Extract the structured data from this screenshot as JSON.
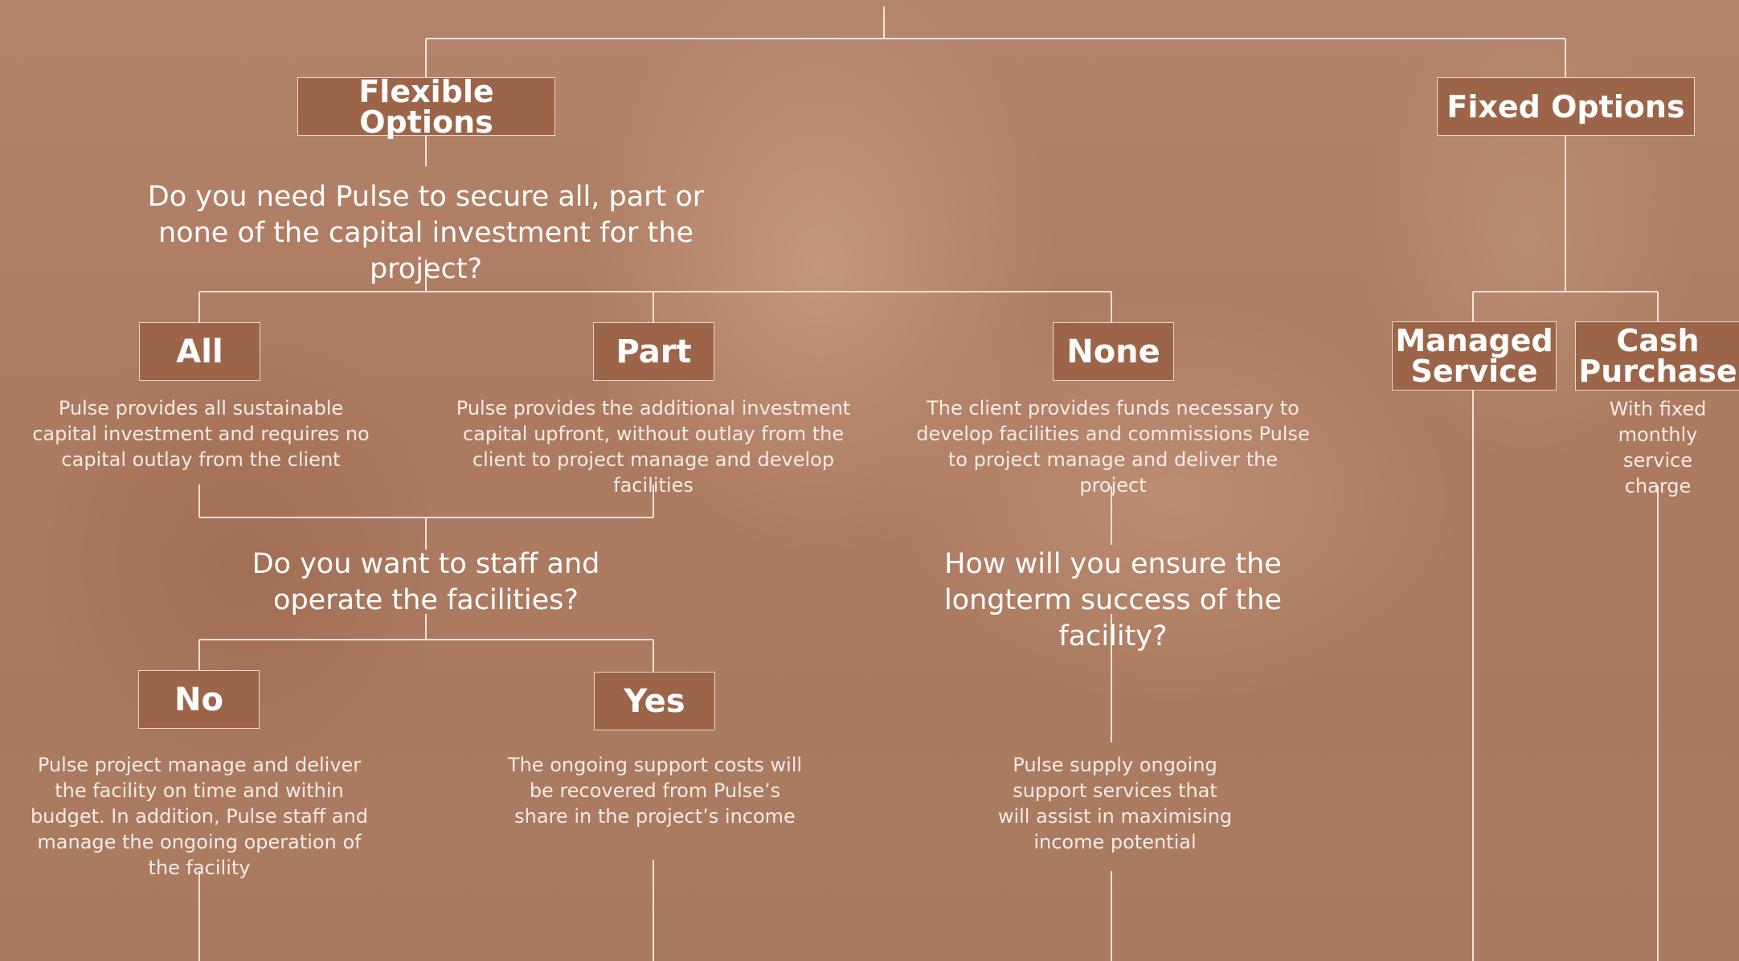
{
  "diagram": {
    "flexible": {
      "title": "Flexible Options",
      "question": "Do you need Pulse to secure all, part or none of the capital investment for the project?",
      "options": {
        "all": {
          "label": "All",
          "desc": "Pulse provides all sustainable capital investment and requires no capital outlay from the client"
        },
        "part": {
          "label": "Part",
          "desc": "Pulse provides the additional investment capital upfront, without outlay from the client to project manage and develop facilities"
        },
        "none": {
          "label": "None",
          "desc": "The client provides funds necessary to develop facilities and commissions Pulse to project manage and deliver the project"
        }
      },
      "staff_question": "Do you want to staff and operate the facilities?",
      "staff_options": {
        "no": {
          "label": "No",
          "desc": "Pulse project manage and deliver the facility on time and within budget. In addition, Pulse staff and manage the ongoing operation of the facility"
        },
        "yes": {
          "label": "Yes",
          "desc": "The ongoing support costs will be recovered from Pulse’s share in the project’s income"
        }
      },
      "success_question": "How will you ensure the longterm success of the facility?",
      "success_desc": "Pulse supply ongoing support services that will assist in maximising income potential"
    },
    "fixed": {
      "title": "Fixed Options",
      "managed": {
        "label": "Managed Service"
      },
      "cash": {
        "label": "Cash Purchase",
        "desc": "With fixed monthly service charge"
      }
    }
  },
  "colors": {
    "background": "#ad7c62",
    "box_fill": "#9c6549",
    "line": "#f1e3da"
  }
}
